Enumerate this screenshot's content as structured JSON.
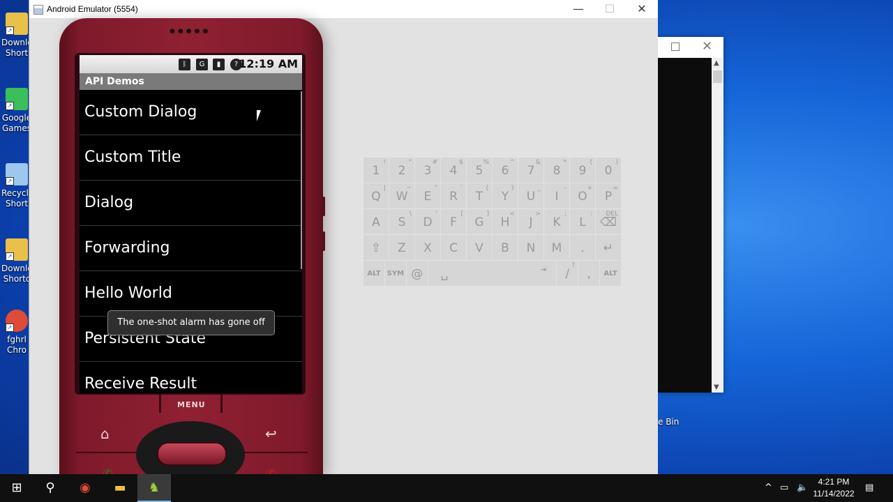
{
  "desktop": {
    "icons": [
      {
        "label1": "Downlo",
        "label2": "Short",
        "icon": "folder-icon",
        "color": "#e8c04a"
      },
      {
        "label1": "Google",
        "label2": "Games",
        "icon": "google-games-icon",
        "color": "#3bbf5a"
      },
      {
        "label1": "Recycle",
        "label2": "Short",
        "icon": "recycle-bin-icon",
        "color": "#9cc8ef"
      },
      {
        "label1": "Downlo",
        "label2": "Shortc",
        "icon": "folder-icon",
        "color": "#e8c04a"
      },
      {
        "label1": "fghrl",
        "label2": "Chro",
        "icon": "chrome-icon",
        "color": "#dd4b39"
      }
    ],
    "recycle_partial": "e Bin"
  },
  "emulator": {
    "title": "Android Emulator (5554)",
    "phone": {
      "status_time": "12:19 AM",
      "app_title": "API Demos",
      "items": [
        "Custom Dialog",
        "Custom Title",
        "Dialog",
        "Forwarding",
        "Hello World",
        "Persistent State",
        "Receive Result"
      ],
      "toast": "The one-shot alarm has gone off",
      "menu_label": "MENU"
    },
    "keyboard": {
      "rows": [
        [
          {
            "m": "1",
            "s": "!"
          },
          {
            "m": "2",
            "s": "\""
          },
          {
            "m": "3",
            "s": "#"
          },
          {
            "m": "4",
            "s": "$"
          },
          {
            "m": "5",
            "s": "%"
          },
          {
            "m": "6",
            "s": "^"
          },
          {
            "m": "7",
            "s": "&"
          },
          {
            "m": "8",
            "s": "*"
          },
          {
            "m": "9",
            "s": "("
          },
          {
            "m": "0",
            "s": ")"
          }
        ],
        [
          {
            "m": "Q",
            "s": "|"
          },
          {
            "m": "W",
            "s": "~"
          },
          {
            "m": "E",
            "s": "\""
          },
          {
            "m": "R",
            "s": "`"
          },
          {
            "m": "T",
            "s": "{"
          },
          {
            "m": "Y",
            "s": "}"
          },
          {
            "m": "U",
            "s": "_"
          },
          {
            "m": "I",
            "s": "-"
          },
          {
            "m": "O",
            "s": "+"
          },
          {
            "m": "P",
            "s": "="
          }
        ],
        [
          {
            "m": "A",
            "s": ""
          },
          {
            "m": "S",
            "s": "\\"
          },
          {
            "m": "D",
            "s": "'"
          },
          {
            "m": "F",
            "s": "["
          },
          {
            "m": "G",
            "s": "]"
          },
          {
            "m": "H",
            "s": "<"
          },
          {
            "m": "J",
            "s": ">"
          },
          {
            "m": "K",
            "s": ";"
          },
          {
            "m": "L",
            "s": ":"
          },
          {
            "m": "⌫",
            "s": "DEL"
          }
        ],
        [
          {
            "m": "⇧",
            "s": ""
          },
          {
            "m": "Z",
            "s": ""
          },
          {
            "m": "X",
            "s": ""
          },
          {
            "m": "C",
            "s": ""
          },
          {
            "m": "V",
            "s": ""
          },
          {
            "m": "B",
            "s": ""
          },
          {
            "m": "N",
            "s": ""
          },
          {
            "m": "M",
            "s": ""
          },
          {
            "m": ".",
            "s": ""
          },
          {
            "m": "↵",
            "s": ""
          }
        ]
      ],
      "bottom": {
        "alt_left": "ALT",
        "sym": "SYM",
        "at": "@",
        "space": "␣",
        "tab": "⇥",
        "slash": "/",
        "question": "?",
        "comma": ",",
        "alt_right": "ALT"
      }
    }
  },
  "bg_window": {
    "close": "✕"
  },
  "taskbar": {
    "clock_time": "4:21 PM",
    "clock_date": "11/14/2022"
  }
}
